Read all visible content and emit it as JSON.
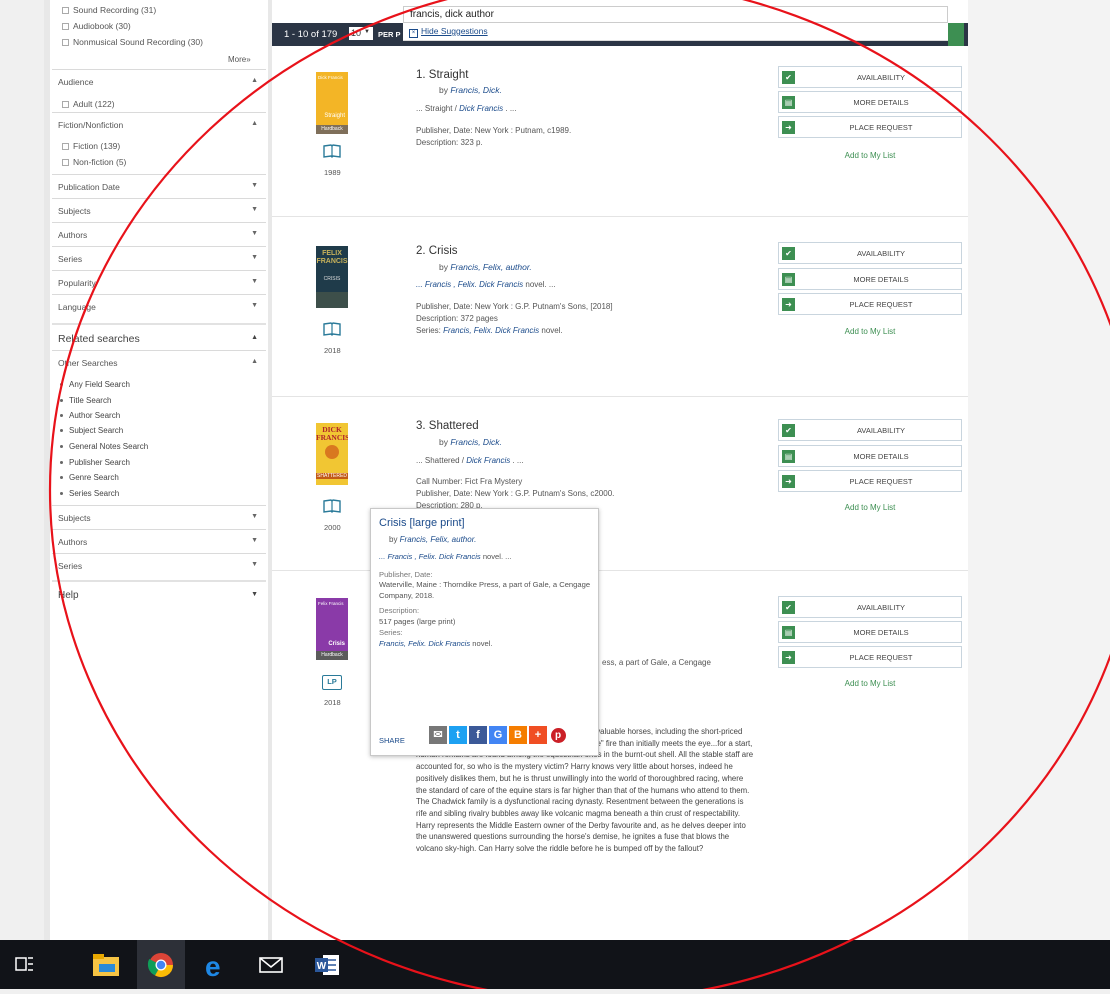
{
  "facets": {
    "format_items": [
      {
        "label": "Sound Recording (31)"
      },
      {
        "label": "Audiobook (30)"
      },
      {
        "label": "Nonmusical Sound Recording (30)"
      }
    ],
    "more_label": "More»",
    "audience": {
      "label": "Audience",
      "items": [
        {
          "label": "Adult (122)"
        }
      ]
    },
    "fiction": {
      "label": "Fiction/Nonfiction",
      "items": [
        {
          "label": "Fiction (139)"
        },
        {
          "label": "Non-fiction (5)"
        }
      ]
    },
    "collapsed": [
      {
        "label": "Publication Date"
      },
      {
        "label": "Subjects"
      },
      {
        "label": "Authors"
      },
      {
        "label": "Series"
      },
      {
        "label": "Popularity"
      },
      {
        "label": "Language"
      }
    ],
    "related_searches": {
      "label": "Related searches",
      "other_label": "Other Searches",
      "links": [
        {
          "label": "Any Field Search"
        },
        {
          "label": "Title Search"
        },
        {
          "label": "Author Search"
        },
        {
          "label": "Subject Search"
        },
        {
          "label": "General Notes Search"
        },
        {
          "label": "Publisher Search"
        },
        {
          "label": "Genre Search"
        },
        {
          "label": "Series Search"
        }
      ],
      "sub_collapsed": [
        {
          "label": "Subjects"
        },
        {
          "label": "Authors"
        },
        {
          "label": "Series"
        }
      ]
    },
    "help_label": "Help"
  },
  "search": {
    "query": "francis, dick author",
    "hide_suggestions": "Hide Suggestions"
  },
  "results_header": {
    "range": "1 - 10 of 179",
    "per_page_value": "10",
    "per_page_label": "PER P"
  },
  "results": [
    {
      "num_title": "1. Straight",
      "by_prefix": "by ",
      "author": "Francis, Dick.",
      "stmt_pre": "... Straight / ",
      "stmt_em": "Dick Francis",
      "stmt_post": " . ...",
      "line1": "Publisher, Date: New York : Putnam, c1989.",
      "line2": "Description: 323 p.",
      "year": "1989"
    },
    {
      "num_title": "2. Crisis",
      "by_prefix": "by ",
      "author": "Francis, Felix, author.",
      "stmt_pre": "... Francis , Felix. ",
      "stmt_em": "Dick Francis",
      "stmt_post": " novel. ...",
      "line1": "Publisher, Date: New York : G.P. Putnam's Sons, [2018]",
      "line2": "Description: 372 pages",
      "series_pre": "Series: ",
      "series_em": "Francis, Felix. Dick Francis",
      "series_post": " novel.",
      "year": "2018"
    },
    {
      "num_title": "3. Shattered",
      "by_prefix": "by ",
      "author": "Francis, Dick.",
      "stmt_pre": "... Shattered / ",
      "stmt_em": "Dick Francis",
      "stmt_post": " . ...",
      "line1": "Call Number: Fict Fra Mystery",
      "line2": "Publisher, Date: New York : G.P. Putnam's Sons, c2000.",
      "line3": "Description: 280 p.",
      "year": "2000"
    },
    {
      "partial_publisher": "ess, a part of Gale, a Cengage",
      "year": "2018",
      "description": "... a London firm, is summoned to ... ss kills six very valuable horses, including the short-priced favorite for the Derby. There is far more to the \"simple\" fire than initially meets the eye...for a start, human remains are found among the equestrian ones in the burnt-out shell. All the stable staff are accounted for, so who is the mystery victim? Harry knows very little about horses, indeed he positively dislikes them, but he is thrust unwillingly into the world of thoroughbred racing, where the standard of care of the equine stars is far higher than that of the humans who attend to them. The Chadwick family is a dysfunctional racing dynasty. Resentment between the generations is rife and sibling rivalry bubbles away like volcanic magma beneath a thin crust of respectability. Harry represents the Middle Eastern owner of the Derby favourite and, as he delves deeper into the unanswered questions surrounding the horse's demise, he ignites a fuse that blows the volcano sky-high. Can Harry solve the riddle before he is bumped off by the fallout?"
    }
  ],
  "covers": {
    "straight_title": "Straight",
    "straight_format": "Hardback",
    "straight_author": "Dick Francis",
    "crisis_author": "FELIX FRANCIS",
    "crisis_title": "CRISIS",
    "shattered_author": "DICK FRANCIS",
    "shattered_title": "SHATTERED",
    "crisis_lp_author": "Felix Francis",
    "crisis_lp_title": "Crisis",
    "crisis_lp_format": "Hardback",
    "lp_badge": "LP"
  },
  "actions": {
    "availability": "AVAILABILITY",
    "more_details": "MORE DETAILS",
    "place_request": "PLACE REQUEST",
    "add_to_list": "Add to My List"
  },
  "popover": {
    "title": "Crisis [large print]",
    "by_prefix": "by ",
    "author": "Francis, Felix, author.",
    "stmt_pre": "... Francis , Felix. ",
    "stmt_em": "Dick Francis",
    "stmt_post": " novel. ...",
    "publisher_label": "Publisher, Date:",
    "publisher_value": "Waterville, Maine : Thorndike Press, a part of Gale, a Cengage Company, 2018.",
    "description_label": "Description:",
    "description_value": "517 pages (large print)",
    "series_label": "Series:",
    "series_pre": "Francis, Felix. ",
    "series_em": "Dick Francis",
    "series_post": " novel.",
    "share_label": "SHARE"
  },
  "colors": {
    "header_bg": "#2b3545",
    "accent_green": "#3d8f52",
    "link_blue": "#1a4a8a",
    "annotation_red": "#e8121a",
    "taskbar": "#111318"
  },
  "taskbar": {
    "icons": [
      "task-view-icon",
      "file-explorer-icon",
      "chrome-icon",
      "edge-icon",
      "mail-icon",
      "word-icon"
    ],
    "word_letter": "W"
  }
}
